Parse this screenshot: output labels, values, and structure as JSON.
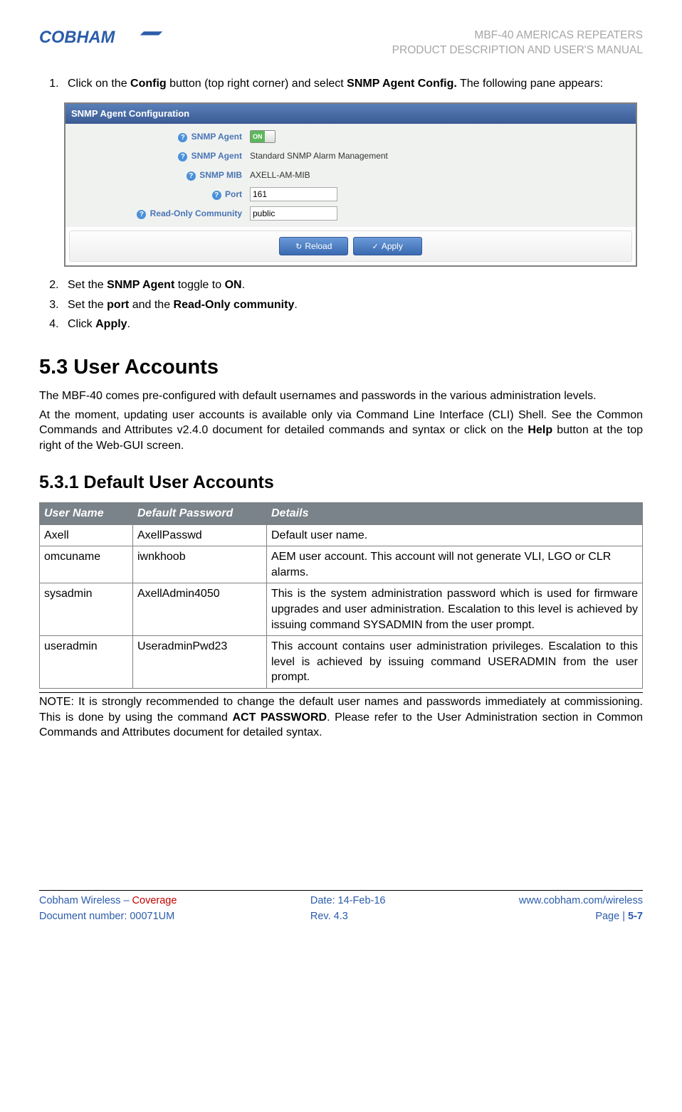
{
  "header": {
    "logo_text": "COBHAM",
    "line1": "MBF-40 AMERICAS REPEATERS",
    "line2": "PRODUCT DESCRIPTION AND USER'S MANUAL"
  },
  "steps_a": {
    "s1_pre": "Click on the ",
    "s1_b1": "Config",
    "s1_mid": " button (top right corner) and select ",
    "s1_b2": "SNMP Agent Config.",
    "s1_post": " The following pane appears:"
  },
  "snmp": {
    "title": "SNMP Agent Configuration",
    "rows": {
      "agent_switch": "SNMP Agent",
      "agent_desc_label": "SNMP Agent",
      "agent_desc_value": "Standard SNMP Alarm Management",
      "mib_label": "SNMP MIB",
      "mib_value": "AXELL-AM-MIB",
      "port_label": "Port",
      "port_value": "161",
      "community_label": "Read-Only Community",
      "community_value": "public"
    },
    "toggle_on": "ON",
    "reload": "Reload",
    "apply": "Apply"
  },
  "steps_b": {
    "s2_pre": "Set the ",
    "s2_b1": "SNMP Agent",
    "s2_mid": " toggle to ",
    "s2_b2": "ON",
    "s2_post": ".",
    "s3_pre": "Set the ",
    "s3_b1": "port",
    "s3_mid": " and the ",
    "s3_b2": "Read-Only community",
    "s3_post": ".",
    "s4_pre": "Click ",
    "s4_b1": "Apply",
    "s4_post": "."
  },
  "sect53": {
    "heading": "5.3   User Accounts",
    "p1": "The MBF-40 comes pre-configured with default usernames and passwords in the various administration levels.",
    "p2_pre": "At the moment, updating user accounts is available only via Command Line Interface (CLI) Shell. See the Common Commands and Attributes v2.4.0 document for detailed commands and syntax or click on the ",
    "p2_b": "Help",
    "p2_post": " button at the top right of the Web-GUI screen."
  },
  "sect531": {
    "heading": "5.3.1   Default User Accounts",
    "th1": "User Name",
    "th2": "Default Password",
    "th3": "Details",
    "rows": [
      {
        "user": "Axell",
        "pwd": "AxellPasswd",
        "details": "Default user name."
      },
      {
        "user": "omcuname",
        "pwd": "iwnkhoob",
        "details": "AEM user account. This account will not generate VLI, LGO or CLR alarms."
      },
      {
        "user": "sysadmin",
        "pwd": "AxellAdmin4050",
        "details": "This is the system administration password which is used for firmware upgrades and user administration. Escalation to this level is achieved by issuing command SYSADMIN from the user prompt."
      },
      {
        "user": "useradmin",
        "pwd": "UseradminPwd23",
        "details": "This account contains user administration privileges. Escalation to this level is achieved by issuing command USERADMIN from the user prompt."
      }
    ],
    "note_pre": "NOTE: It is strongly recommended to change the default user names and passwords immediately at commissioning. This is done by using the command ",
    "note_b": "ACT PASSWORD",
    "note_post": ". Please refer to the User Administration section in Common Commands and Attributes document for detailed syntax."
  },
  "footer": {
    "l1_a": "Cobham Wireless",
    "l1_b": " – ",
    "l1_c": "Coverage",
    "l2": "Document number: 00071UM",
    "m1": "Date: 14-Feb-16",
    "m2": "Rev. 4.3",
    "r1": "www.cobham.com/wireless",
    "r2_a": "Page | ",
    "r2_b": "5-7"
  }
}
